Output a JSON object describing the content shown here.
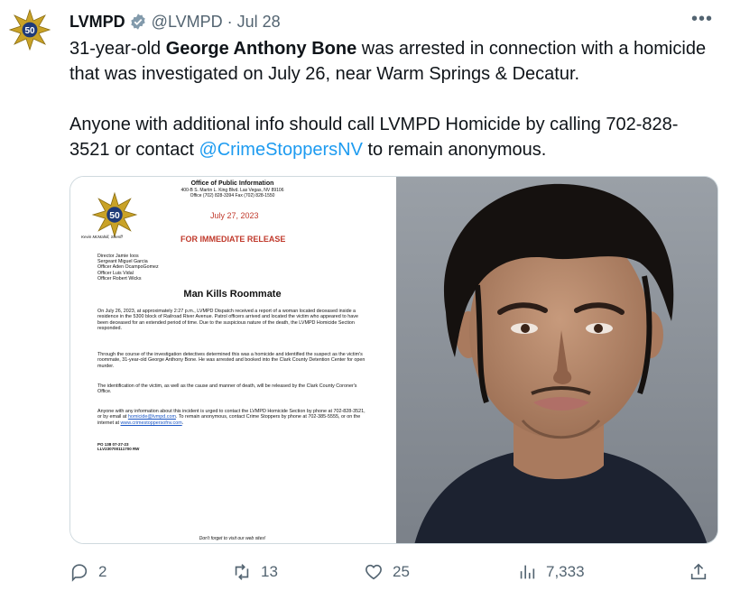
{
  "author": {
    "name": "LVMPD",
    "handle": "@LVMPD",
    "separator": "·",
    "date": "Jul 28",
    "badge_number": "50"
  },
  "tweet": {
    "line1_pre": "31-year-old ",
    "line1_bold": "George Anthony Bone",
    "line1_post": " was arrested in connection with a homicide that was investigated on July 26, near Warm Springs & Decatur.",
    "line2_pre": "Anyone with additional info should call LVMPD Homicide by calling 702-828-3521 or contact ",
    "line2_mention": "@CrimeStoppersNV",
    "line2_post": " to remain anonymous."
  },
  "document": {
    "office": "Office of Public Information",
    "address": "400-B S. Martin L. King Blvd. Las Vegas, NV 89106",
    "phone": "Office (702) 828-3394   Fax (702) 828-1550",
    "badge_number": "50",
    "sheriff": "Kevin McMahill, Sheriff",
    "date": "July 27, 2023",
    "release": "FOR IMMEDIATE RELEASE",
    "staff": [
      "Director Jamie Ioos",
      "Sergeant Miguel Garcia",
      "Officer Aden OcampoGomez",
      "Officer Luis Vidal",
      "Officer Robert Wicks"
    ],
    "headline": "Man Kills Roommate",
    "p1": "On July 26, 2023, at approximately 2:27 p.m., LVMPD Dispatch received a report of a woman located deceased inside a residence in the 5300 block of Railroad River Avenue. Patrol officers arrived and located the victim who appeared to have been deceased for an extended period of time.  Due to the suspicious nature of the death, the LVMPD Homicide Section responded.",
    "p2": "Through the course of the investigation detectives determined this was a homicide and identified the suspect as the victim's roommate, 31-year-old George Anthony Bone. He was arrested and booked into the Clark County Detention Center for open murder.",
    "p3": "The identification of the victim, as well as the cause and manner of death, will be released by the Clark County Coroner's Office.",
    "p4_pre": "Anyone with any information about this incident is urged to contact the LVMPD Homicide Section by phone at 702-828-3521, or by email at ",
    "p4_email": "homicide@lvmpd.com",
    "p4_mid": ". To remain anonymous, contact Crime Stoppers by phone at 702-385-5555, or on the internet at ",
    "p4_url": "www.crimestoppersofnv.com",
    "p4_post": ".",
    "ref1": "PO 138 07-27-23",
    "ref2": "LLV230700111700 RW",
    "footer": "Don't forget to visit our web sites!"
  },
  "actions": {
    "replies": "2",
    "retweets": "13",
    "likes": "25",
    "views": "7,333"
  },
  "colors": {
    "link": "#1d9bf0",
    "muted": "#536471",
    "release_red": "#c0392b"
  }
}
